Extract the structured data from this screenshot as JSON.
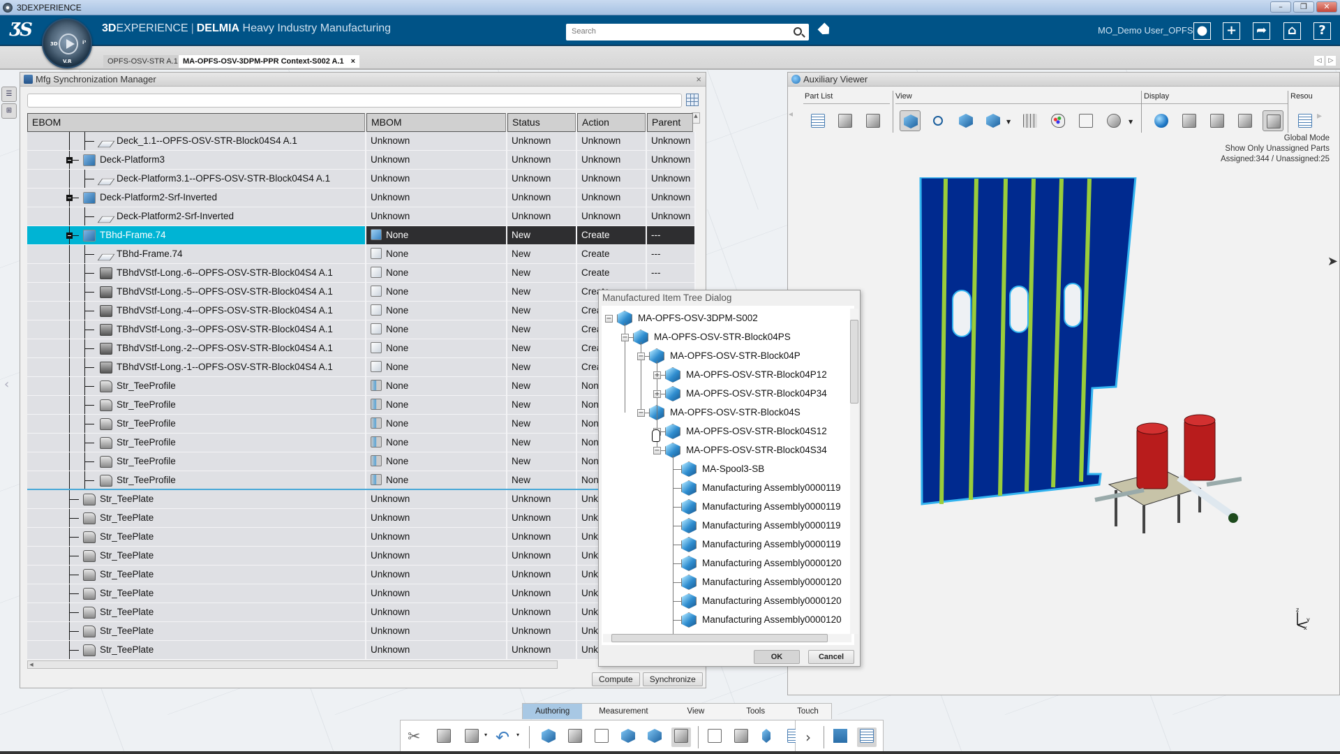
{
  "window": {
    "title": "3DEXPERIENCE",
    "controls": [
      "minimize",
      "restore",
      "close"
    ]
  },
  "header": {
    "brand_prefix": "3D",
    "brand_experience": "EXPERIENCE",
    "brand_separator": "|",
    "brand_product": "DELMIA",
    "brand_app": "Heavy Industry Manufacturing",
    "compass_labels": [
      "3D",
      "V.R",
      "i³"
    ],
    "search_placeholder": "Search",
    "user_name": "MO_Demo User_OPFS",
    "buttons": [
      "user-profile",
      "add",
      "share",
      "home",
      "help"
    ],
    "help_label": "?",
    "add_label": "+"
  },
  "tabs": [
    {
      "label": "OPFS-OSV-STR A.1",
      "active": false
    },
    {
      "label": "MA-OPFS-OSV-3DPM-PPR Context-S002 A.1",
      "active": true,
      "close": "×"
    }
  ],
  "mfg_panel": {
    "title": "Mfg Synchronization Manager",
    "close": "×",
    "filter_value": "",
    "columns": [
      "EBOM",
      "MBOM",
      "Status",
      "Action",
      "Parent"
    ],
    "rows": [
      {
        "ebom": "Deck_1.1--OPFS-OSV-STR-Block04S4 A.1",
        "mbom": "Unknown",
        "status": "Unknown",
        "action": "Unknown",
        "parent": "Unknown",
        "depth": 2,
        "icon": "sheet"
      },
      {
        "ebom": "Deck-Platform3",
        "mbom": "Unknown",
        "status": "Unknown",
        "action": "Unknown",
        "parent": "Unknown",
        "depth": 1,
        "icon": "part",
        "expanded": true
      },
      {
        "ebom": "Deck-Platform3.1--OPFS-OSV-STR-Block04S4 A.1",
        "mbom": "Unknown",
        "status": "Unknown",
        "action": "Unknown",
        "parent": "Unknown",
        "depth": 2,
        "icon": "sheet"
      },
      {
        "ebom": "Deck-Platform2-Srf-Inverted",
        "mbom": "Unknown",
        "status": "Unknown",
        "action": "Unknown",
        "parent": "Unknown",
        "depth": 1,
        "icon": "part",
        "expanded": true
      },
      {
        "ebom": "Deck-Platform2-Srf-Inverted",
        "mbom": "Unknown",
        "status": "Unknown",
        "action": "Unknown",
        "parent": "Unknown",
        "depth": 2,
        "icon": "sheet"
      },
      {
        "ebom": "TBhd-Frame.74",
        "mbom": "None",
        "status": "New",
        "action": "Create",
        "parent": "---",
        "depth": 1,
        "icon": "part",
        "expanded": true,
        "selected": true,
        "mbom_icon": "blue"
      },
      {
        "ebom": "TBhd-Frame.74",
        "mbom": "None",
        "status": "New",
        "action": "Create",
        "parent": "---",
        "depth": 2,
        "icon": "sheet",
        "mbom_icon": "white"
      },
      {
        "ebom": "TBhdVStf-Long.-6--OPFS-OSV-STR-Block04S4 A.1",
        "mbom": "None",
        "status": "New",
        "action": "Create",
        "parent": "---",
        "depth": 2,
        "icon": "profile",
        "mbom_icon": "white"
      },
      {
        "ebom": "TBhdVStf-Long.-5--OPFS-OSV-STR-Block04S4 A.1",
        "mbom": "None",
        "status": "New",
        "action": "Create",
        "parent": "",
        "depth": 2,
        "icon": "profile",
        "mbom_icon": "white"
      },
      {
        "ebom": "TBhdVStf-Long.-4--OPFS-OSV-STR-Block04S4 A.1",
        "mbom": "None",
        "status": "New",
        "action": "Create",
        "parent": "",
        "depth": 2,
        "icon": "profile",
        "mbom_icon": "white"
      },
      {
        "ebom": "TBhdVStf-Long.-3--OPFS-OSV-STR-Block04S4 A.1",
        "mbom": "None",
        "status": "New",
        "action": "Create",
        "parent": "",
        "depth": 2,
        "icon": "profile",
        "mbom_icon": "white"
      },
      {
        "ebom": "TBhdVStf-Long.-2--OPFS-OSV-STR-Block04S4 A.1",
        "mbom": "None",
        "status": "New",
        "action": "Create",
        "parent": "",
        "depth": 2,
        "icon": "profile",
        "mbom_icon": "white"
      },
      {
        "ebom": "TBhdVStf-Long.-1--OPFS-OSV-STR-Block04S4 A.1",
        "mbom": "None",
        "status": "New",
        "action": "Create",
        "parent": "",
        "depth": 2,
        "icon": "profile",
        "mbom_icon": "white"
      },
      {
        "ebom": "Str_TeeProfile",
        "mbom": "None",
        "status": "New",
        "action": "None",
        "parent": "",
        "depth": 2,
        "icon": "tee",
        "mbom_icon": "bolt"
      },
      {
        "ebom": "Str_TeeProfile",
        "mbom": "None",
        "status": "New",
        "action": "None",
        "parent": "",
        "depth": 2,
        "icon": "tee",
        "mbom_icon": "bolt"
      },
      {
        "ebom": "Str_TeeProfile",
        "mbom": "None",
        "status": "New",
        "action": "None",
        "parent": "",
        "depth": 2,
        "icon": "tee",
        "mbom_icon": "bolt"
      },
      {
        "ebom": "Str_TeeProfile",
        "mbom": "None",
        "status": "New",
        "action": "None",
        "parent": "",
        "depth": 2,
        "icon": "tee",
        "mbom_icon": "bolt"
      },
      {
        "ebom": "Str_TeeProfile",
        "mbom": "None",
        "status": "New",
        "action": "None",
        "parent": "",
        "depth": 2,
        "icon": "tee",
        "mbom_icon": "bolt"
      },
      {
        "ebom": "Str_TeeProfile",
        "mbom": "None",
        "status": "New",
        "action": "None",
        "parent": "",
        "depth": 2,
        "icon": "tee",
        "mbom_icon": "bolt",
        "group_end": true
      },
      {
        "ebom": "Str_TeePlate",
        "mbom": "Unknown",
        "status": "Unknown",
        "action": "Unknown",
        "parent": "",
        "depth": 1,
        "icon": "tee"
      },
      {
        "ebom": "Str_TeePlate",
        "mbom": "Unknown",
        "status": "Unknown",
        "action": "Unknown",
        "parent": "",
        "depth": 1,
        "icon": "tee"
      },
      {
        "ebom": "Str_TeePlate",
        "mbom": "Unknown",
        "status": "Unknown",
        "action": "Unknown",
        "parent": "",
        "depth": 1,
        "icon": "tee"
      },
      {
        "ebom": "Str_TeePlate",
        "mbom": "Unknown",
        "status": "Unknown",
        "action": "Unknown",
        "parent": "",
        "depth": 1,
        "icon": "tee"
      },
      {
        "ebom": "Str_TeePlate",
        "mbom": "Unknown",
        "status": "Unknown",
        "action": "Unknown",
        "parent": "",
        "depth": 1,
        "icon": "tee"
      },
      {
        "ebom": "Str_TeePlate",
        "mbom": "Unknown",
        "status": "Unknown",
        "action": "Unknown",
        "parent": "",
        "depth": 1,
        "icon": "tee"
      },
      {
        "ebom": "Str_TeePlate",
        "mbom": "Unknown",
        "status": "Unknown",
        "action": "Unknown",
        "parent": "",
        "depth": 1,
        "icon": "tee"
      },
      {
        "ebom": "Str_TeePlate",
        "mbom": "Unknown",
        "status": "Unknown",
        "action": "Unknown",
        "parent": "",
        "depth": 1,
        "icon": "tee"
      },
      {
        "ebom": "Str_TeePlate",
        "mbom": "Unknown",
        "status": "Unknown",
        "action": "Unknown",
        "parent": "",
        "depth": 1,
        "icon": "tee"
      }
    ],
    "compute_label": "Compute",
    "synchronize_label": "Synchronize"
  },
  "dialog": {
    "title": "Manufactured Item Tree Dialog",
    "nodes": [
      {
        "label": "MA-OPFS-OSV-3DPM-S002",
        "level": 0,
        "toggle": "−"
      },
      {
        "label": "MA-OPFS-OSV-STR-Block04PS",
        "level": 1,
        "toggle": "−"
      },
      {
        "label": "MA-OPFS-OSV-STR-Block04P",
        "level": 2,
        "toggle": "−"
      },
      {
        "label": "MA-OPFS-OSV-STR-Block04P12",
        "level": 3,
        "toggle": "+"
      },
      {
        "label": "MA-OPFS-OSV-STR-Block04P34",
        "level": 3,
        "toggle": "+"
      },
      {
        "label": "MA-OPFS-OSV-STR-Block04S",
        "level": 2,
        "toggle": "−"
      },
      {
        "label": "MA-OPFS-OSV-STR-Block04S12",
        "level": 3,
        "toggle": "+"
      },
      {
        "label": "MA-OPFS-OSV-STR-Block04S34",
        "level": 3,
        "toggle": "−"
      },
      {
        "label": "MA-Spool3-SB",
        "level": 4,
        "toggle": ""
      },
      {
        "label": "Manufacturing Assembly0000119",
        "level": 4,
        "toggle": ""
      },
      {
        "label": "Manufacturing Assembly0000119",
        "level": 4,
        "toggle": ""
      },
      {
        "label": "Manufacturing Assembly0000119",
        "level": 4,
        "toggle": ""
      },
      {
        "label": "Manufacturing Assembly0000119",
        "level": 4,
        "toggle": ""
      },
      {
        "label": "Manufacturing Assembly0000120",
        "level": 4,
        "toggle": ""
      },
      {
        "label": "Manufacturing Assembly0000120",
        "level": 4,
        "toggle": ""
      },
      {
        "label": "Manufacturing Assembly0000120",
        "level": 4,
        "toggle": ""
      },
      {
        "label": "Manufacturing Assembly0000120",
        "level": 4,
        "toggle": ""
      }
    ],
    "ok_label": "OK",
    "cancel_label": "Cancel"
  },
  "aux_viewer": {
    "title": "Auxiliary Viewer",
    "sections": [
      "Part List",
      "View",
      "Display",
      "Resou"
    ],
    "info": [
      "Global Mode",
      "Show Only Unassigned Parts",
      "Assigned:344 / Unassigned:25"
    ],
    "axis_labels": [
      "z",
      "y",
      "x"
    ]
  },
  "action_bar": {
    "tabs": [
      "Authoring",
      "Measurement",
      "View",
      "Tools",
      "Touch"
    ],
    "active_tab": "Authoring",
    "tools": [
      "cut",
      "copy",
      "paste",
      "undo",
      "insert-product",
      "edit-part",
      "manufacturing-tools",
      "add-assembly",
      "3d-part",
      "synchronize",
      "assignment",
      "open",
      "fastener",
      "table",
      "more",
      "tree-layout",
      "flow-layout"
    ]
  },
  "colors": {
    "header_bg": "#005387",
    "selection_cyan": "#00b4d4",
    "selection_dark": "#2e2e30",
    "plate_blue": "#002a8f",
    "stiffener_green": "#9acd3a",
    "pump_red": "#b81c1c"
  }
}
